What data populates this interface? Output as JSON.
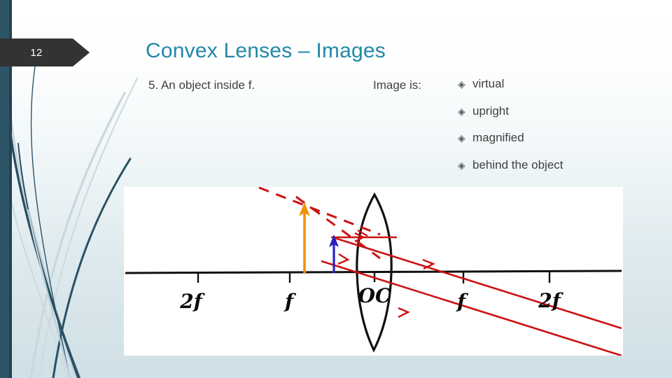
{
  "slide": {
    "page_number": "12",
    "title": "Convex Lenses – Images",
    "title_color": "#2089a8",
    "accent_bar_color": "#2e5468",
    "banner_color": "#333333"
  },
  "body": {
    "stem": "5.  An object inside f.",
    "image_is_label": "Image is:",
    "bullet_glyph": "◈",
    "bullets": [
      {
        "glyph": "◈",
        "label": "virtual"
      },
      {
        "glyph": "◈",
        "label": "upright"
      },
      {
        "glyph": "◈",
        "label": "magnified"
      },
      {
        "glyph": "◈",
        "label": "behind the object"
      }
    ]
  },
  "diagram": {
    "axis_labels": [
      {
        "text": "2f",
        "side": "left"
      },
      {
        "text": "f",
        "side": "left"
      },
      {
        "text": "OC",
        "side": "center"
      },
      {
        "text": "f",
        "side": "right"
      },
      {
        "text": "2f",
        "side": "right"
      }
    ],
    "object_arrow": {
      "name": "object",
      "color": "#2a1fc4"
    },
    "image_arrow": {
      "name": "image",
      "color": "#f19100"
    },
    "ray_color": "#cc1111",
    "axis_color": "#111111",
    "lens_color": "#111111",
    "panel_background": "#ffffff"
  }
}
